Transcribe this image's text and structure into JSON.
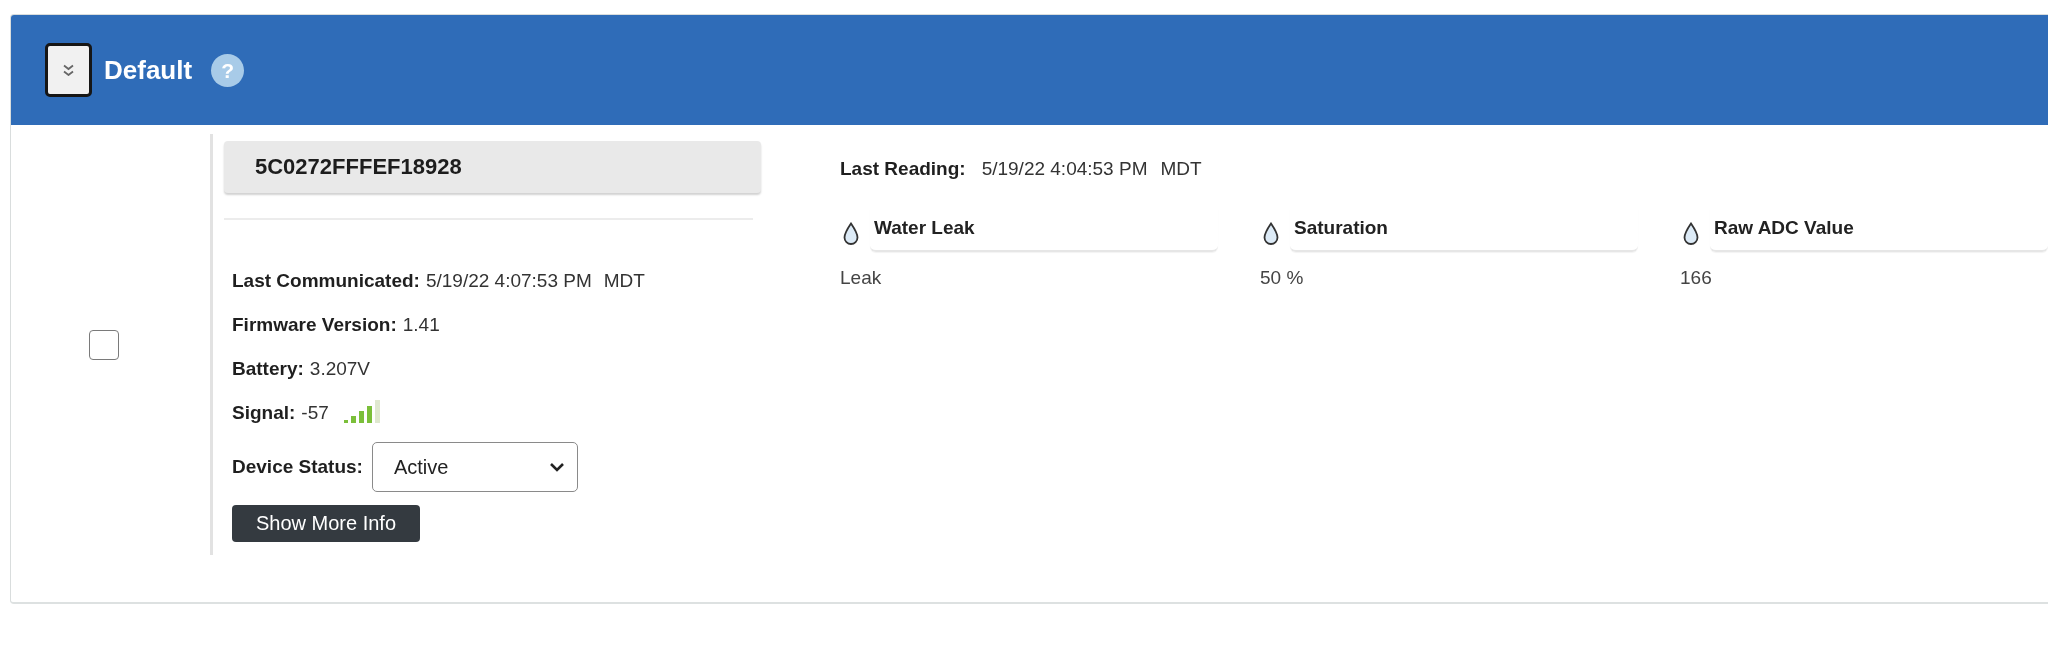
{
  "group": {
    "title": "Default",
    "help": "?"
  },
  "device": {
    "checked": false,
    "id": "5C0272FFFEF18928",
    "details": [
      {
        "kind": "text",
        "label": "Last Communicated:",
        "value": "5/19/22 4:07:53 PM",
        "zone": "MDT"
      },
      {
        "kind": "text",
        "label": "Firmware Version:",
        "value": "1.41"
      },
      {
        "kind": "text",
        "label": "Battery:",
        "value": "3.207V"
      },
      {
        "kind": "signal",
        "label": "Signal:",
        "value": "-57"
      }
    ],
    "status": {
      "label": "Device Status:",
      "value": "Active"
    },
    "more_button": "Show More Info"
  },
  "last_reading": {
    "label": "Last Reading:",
    "value": "5/19/22 4:04:53 PM",
    "zone": "MDT"
  },
  "readings": [
    {
      "name": "Water Leak",
      "value": "Leak"
    },
    {
      "name": "Saturation",
      "value": "50 %"
    },
    {
      "name": "Raw ADC Value",
      "value": "166"
    }
  ]
}
